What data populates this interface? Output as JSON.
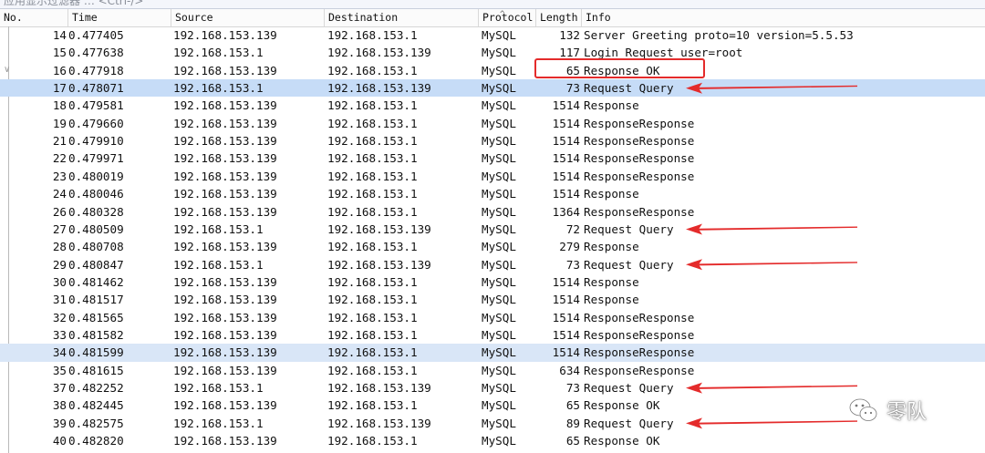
{
  "filter_hint": "应用显示过滤器 … <Ctrl-/>",
  "columns": {
    "no": "No.",
    "time": "Time",
    "source": "Source",
    "destination": "Destination",
    "protocol": "Protocol",
    "length": "Length",
    "info": "Info"
  },
  "packets": [
    {
      "no": "14",
      "time": "0.477405",
      "src": "192.168.153.139",
      "dst": "192.168.153.1",
      "proto": "MySQL",
      "len": "132",
      "info": "Server Greeting proto=10 version=5.5.53"
    },
    {
      "no": "15",
      "time": "0.477638",
      "src": "192.168.153.1",
      "dst": "192.168.153.139",
      "proto": "MySQL",
      "len": "117",
      "info": "Login Request user=root"
    },
    {
      "no": "16",
      "time": "0.477918",
      "src": "192.168.153.139",
      "dst": "192.168.153.1",
      "proto": "MySQL",
      "len": "65",
      "info": "Response OK"
    },
    {
      "no": "17",
      "time": "0.478071",
      "src": "192.168.153.1",
      "dst": "192.168.153.139",
      "proto": "MySQL",
      "len": "73",
      "info": "Request Query"
    },
    {
      "no": "18",
      "time": "0.479581",
      "src": "192.168.153.139",
      "dst": "192.168.153.1",
      "proto": "MySQL",
      "len": "1514",
      "info": "Response"
    },
    {
      "no": "19",
      "time": "0.479660",
      "src": "192.168.153.139",
      "dst": "192.168.153.1",
      "proto": "MySQL",
      "len": "1514",
      "info": "ResponseResponse"
    },
    {
      "no": "21",
      "time": "0.479910",
      "src": "192.168.153.139",
      "dst": "192.168.153.1",
      "proto": "MySQL",
      "len": "1514",
      "info": "ResponseResponse"
    },
    {
      "no": "22",
      "time": "0.479971",
      "src": "192.168.153.139",
      "dst": "192.168.153.1",
      "proto": "MySQL",
      "len": "1514",
      "info": "ResponseResponse"
    },
    {
      "no": "23",
      "time": "0.480019",
      "src": "192.168.153.139",
      "dst": "192.168.153.1",
      "proto": "MySQL",
      "len": "1514",
      "info": "ResponseResponse"
    },
    {
      "no": "24",
      "time": "0.480046",
      "src": "192.168.153.139",
      "dst": "192.168.153.1",
      "proto": "MySQL",
      "len": "1514",
      "info": "Response"
    },
    {
      "no": "26",
      "time": "0.480328",
      "src": "192.168.153.139",
      "dst": "192.168.153.1",
      "proto": "MySQL",
      "len": "1364",
      "info": "ResponseResponse"
    },
    {
      "no": "27",
      "time": "0.480509",
      "src": "192.168.153.1",
      "dst": "192.168.153.139",
      "proto": "MySQL",
      "len": "72",
      "info": "Request Query"
    },
    {
      "no": "28",
      "time": "0.480708",
      "src": "192.168.153.139",
      "dst": "192.168.153.1",
      "proto": "MySQL",
      "len": "279",
      "info": "Response"
    },
    {
      "no": "29",
      "time": "0.480847",
      "src": "192.168.153.1",
      "dst": "192.168.153.139",
      "proto": "MySQL",
      "len": "73",
      "info": "Request Query"
    },
    {
      "no": "30",
      "time": "0.481462",
      "src": "192.168.153.139",
      "dst": "192.168.153.1",
      "proto": "MySQL",
      "len": "1514",
      "info": "Response"
    },
    {
      "no": "31",
      "time": "0.481517",
      "src": "192.168.153.139",
      "dst": "192.168.153.1",
      "proto": "MySQL",
      "len": "1514",
      "info": "Response"
    },
    {
      "no": "32",
      "time": "0.481565",
      "src": "192.168.153.139",
      "dst": "192.168.153.1",
      "proto": "MySQL",
      "len": "1514",
      "info": "ResponseResponse"
    },
    {
      "no": "33",
      "time": "0.481582",
      "src": "192.168.153.139",
      "dst": "192.168.153.1",
      "proto": "MySQL",
      "len": "1514",
      "info": "ResponseResponse"
    },
    {
      "no": "34",
      "time": "0.481599",
      "src": "192.168.153.139",
      "dst": "192.168.153.1",
      "proto": "MySQL",
      "len": "1514",
      "info": "ResponseResponse"
    },
    {
      "no": "35",
      "time": "0.481615",
      "src": "192.168.153.139",
      "dst": "192.168.153.1",
      "proto": "MySQL",
      "len": "634",
      "info": "ResponseResponse"
    },
    {
      "no": "37",
      "time": "0.482252",
      "src": "192.168.153.1",
      "dst": "192.168.153.139",
      "proto": "MySQL",
      "len": "73",
      "info": "Request Query"
    },
    {
      "no": "38",
      "time": "0.482445",
      "src": "192.168.153.139",
      "dst": "192.168.153.1",
      "proto": "MySQL",
      "len": "65",
      "info": "Response OK"
    },
    {
      "no": "39",
      "time": "0.482575",
      "src": "192.168.153.1",
      "dst": "192.168.153.139",
      "proto": "MySQL",
      "len": "89",
      "info": "Request Query"
    },
    {
      "no": "40",
      "time": "0.482820",
      "src": "192.168.153.139",
      "dst": "192.168.153.1",
      "proto": "MySQL",
      "len": "65",
      "info": "Response OK"
    }
  ],
  "selected_packet": "17",
  "secondary_highlight_packet": "34",
  "annotation_color": "#e42b2b",
  "watermark": {
    "icon": "wechat-icon",
    "text": "零队"
  }
}
